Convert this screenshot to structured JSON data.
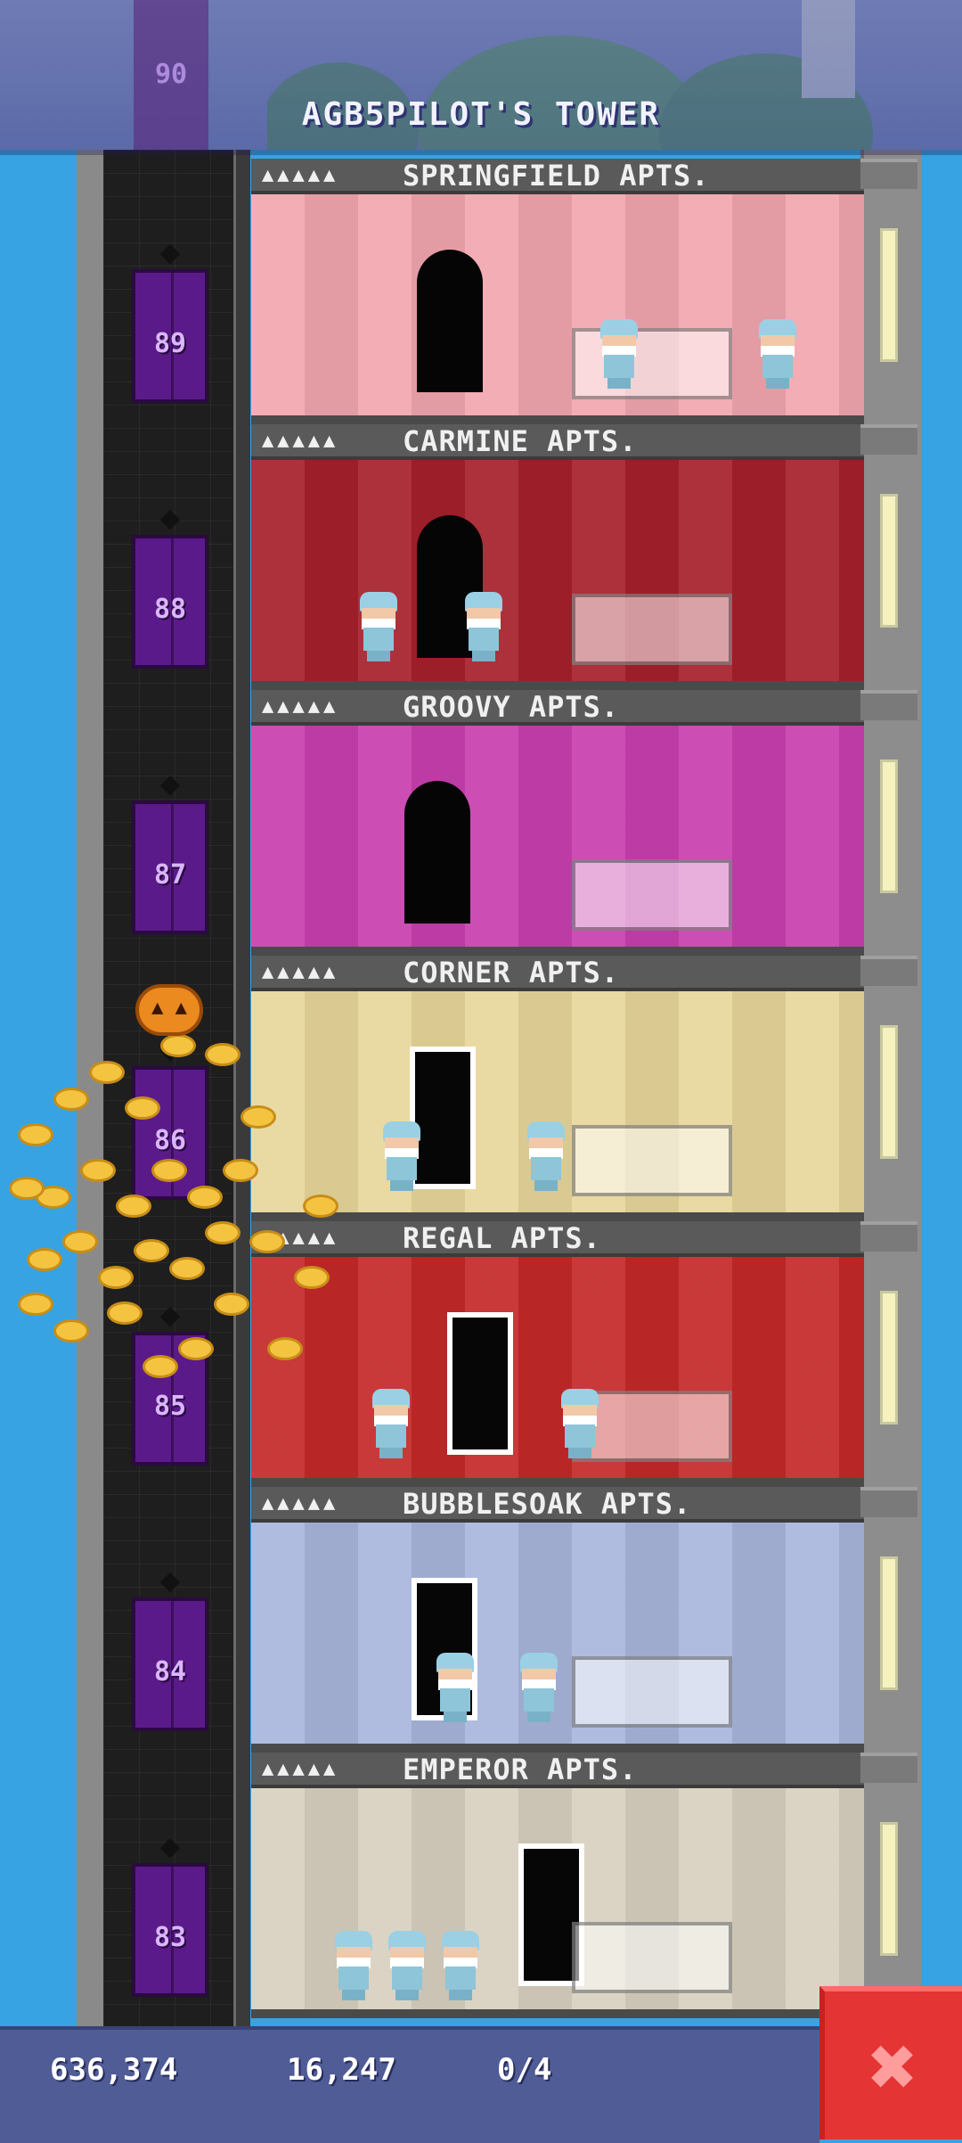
{
  "header": {
    "title": "AGB5PILOT'S TOWER",
    "top_floor_number": "90"
  },
  "floors": [
    {
      "number": "89",
      "name": "SPRINGFIELD APTS.",
      "residents": "▲▲▲▲▲",
      "wall_color": "#f2a6ae"
    },
    {
      "number": "88",
      "name": "CARMINE APTS.",
      "residents": "▲▲▲▲▲",
      "wall_color": "#a5202a"
    },
    {
      "number": "87",
      "name": "GROOVY APTS.",
      "residents": "▲▲▲▲▲",
      "wall_color": "#c83fae"
    },
    {
      "number": "86",
      "name": "CORNER APTS.",
      "residents": "▲▲▲▲▲",
      "wall_color": "#e7d79b"
    },
    {
      "number": "85",
      "name": "REGAL APTS.",
      "residents": "▲▲▲▲▲",
      "wall_color": "#c42828"
    },
    {
      "number": "84",
      "name": "BUBBLESOAK APTS.",
      "residents": "▲▲▲▲▲",
      "wall_color": "#a8b6dc"
    },
    {
      "number": "83",
      "name": "EMPEROR APTS.",
      "residents": "▲▲▲▲▲",
      "wall_color": "#d8d0bf"
    }
  ],
  "resources": {
    "coins": "636,374",
    "bux": "16,247",
    "tickets": "0/4"
  },
  "close_label": "✖",
  "colors": {
    "sky": "#37a3e2",
    "header": "#5b6aa8",
    "elevator": "#5b1a8a",
    "close_button": "#e43434",
    "coin": "#f3c43a"
  }
}
